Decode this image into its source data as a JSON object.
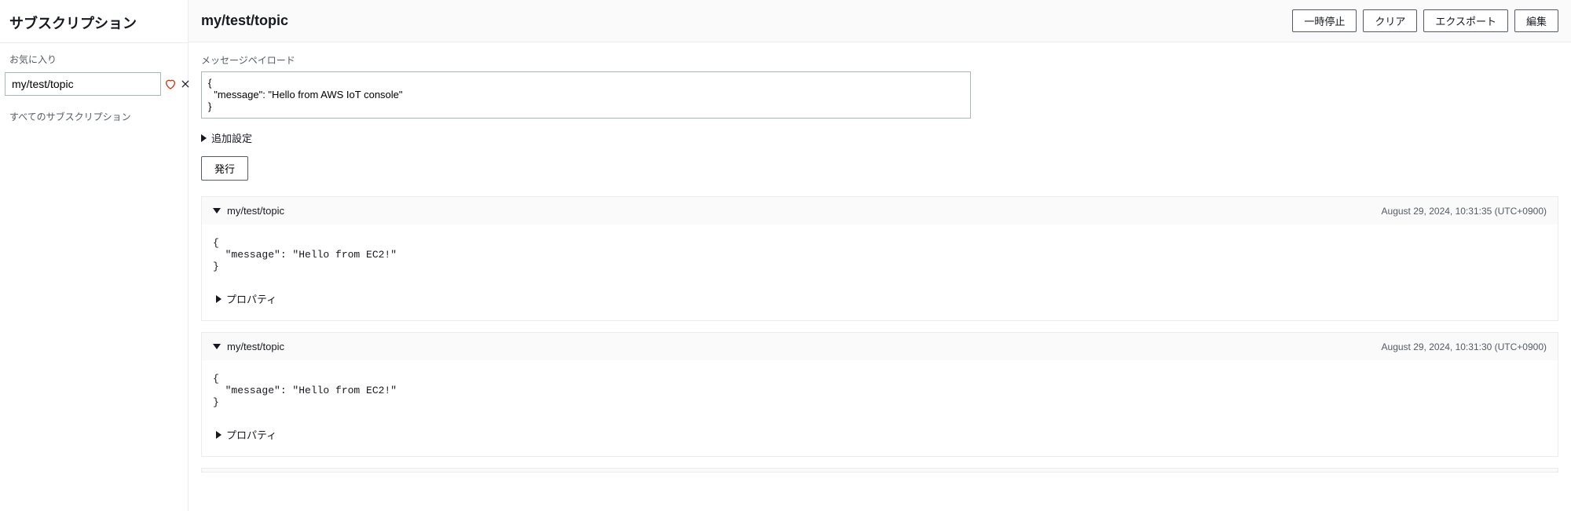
{
  "sidebar": {
    "title": "サブスクリプション",
    "favorites_label": "お気に入り",
    "topic_input_value": "my/test/topic",
    "all_subscriptions_label": "すべてのサブスクリプション"
  },
  "header": {
    "topic_title": "my/test/topic",
    "buttons": {
      "pause": "一時停止",
      "clear": "クリア",
      "export": "エクスポート",
      "edit": "編集"
    }
  },
  "publish": {
    "payload_label": "メッセージペイロード",
    "payload_value": "{\n  \"message\": \"Hello from AWS IoT console\"\n}",
    "additional_settings": "追加設定",
    "publish_button": "発行"
  },
  "messages": [
    {
      "topic": "my/test/topic",
      "timestamp": "August 29, 2024, 10:31:35 (UTC+0900)",
      "payload": "{\n  \"message\": \"Hello from EC2!\"\n}",
      "properties_label": "プロパティ"
    },
    {
      "topic": "my/test/topic",
      "timestamp": "August 29, 2024, 10:31:30 (UTC+0900)",
      "payload": "{\n  \"message\": \"Hello from EC2!\"\n}",
      "properties_label": "プロパティ"
    }
  ]
}
